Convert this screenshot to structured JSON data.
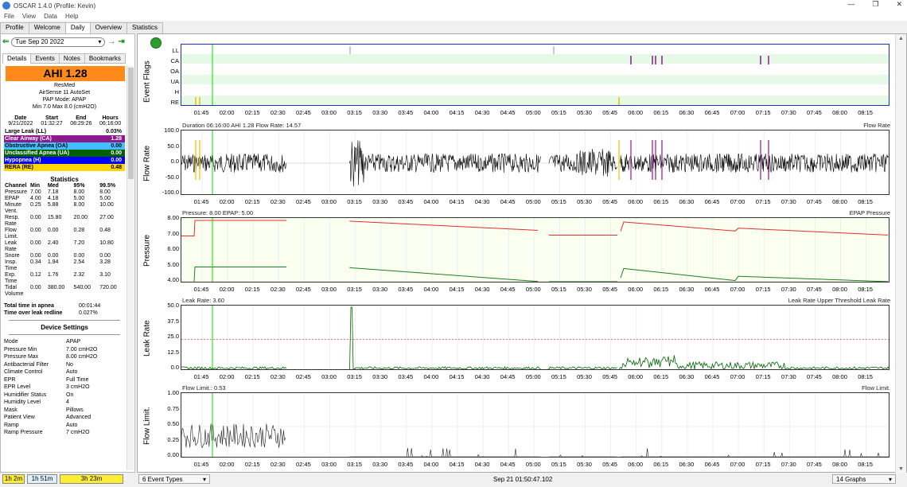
{
  "window": {
    "title": "OSCAR 1.4.0 (Profile: Kevin)",
    "controls": [
      "—",
      "❐",
      "✕"
    ]
  },
  "menu": [
    "File",
    "View",
    "Data",
    "Help"
  ],
  "tabs": [
    "Profile",
    "Welcome",
    "Daily",
    "Overview",
    "Statistics"
  ],
  "active_tab": "Daily",
  "date": {
    "prev": "⇐",
    "value": "Tue Sep 20 2022",
    "next": "→",
    "latest": "⇥"
  },
  "subtabs": [
    "Details",
    "Events",
    "Notes",
    "Bookmarks"
  ],
  "ahi": "AHI 1.28",
  "device": {
    "brand": "ResMed",
    "model": "AirSense 11 AutoSet",
    "mode": "PAP Mode: APAP",
    "pressure": "Min 7.0 Max 8.0 (cmH2O)"
  },
  "session": {
    "headers": [
      "Date",
      "Start",
      "End",
      "Hours"
    ],
    "values": [
      "9/21/2022",
      "01:32:27",
      "08:29:26",
      "06:16:00"
    ]
  },
  "events": [
    {
      "label": "Large Leak (LL)",
      "value": "0.03%",
      "bg": "#ffffff",
      "fg": "#000000"
    },
    {
      "label": "Clear Airway (CA)",
      "value": "1.28",
      "bg": "#8b1a8b",
      "fg": "#ffffff"
    },
    {
      "label": "Obstructive Apnea (OA)",
      "value": "0.00",
      "bg": "#40c0ff",
      "fg": "#000000"
    },
    {
      "label": "Unclassified Apnea (UA)",
      "value": "0.00",
      "bg": "#006000",
      "fg": "#ffffff"
    },
    {
      "label": "Hypopnea (H)",
      "value": "0.00",
      "bg": "#0000ff",
      "fg": "#ffffff"
    },
    {
      "label": "RERA (RE)",
      "value": "0.48",
      "bg": "#ffd700",
      "fg": "#000000"
    }
  ],
  "statistics": {
    "title": "Statistics",
    "headers": [
      "Channel",
      "Min",
      "Med",
      "95%",
      "99.5%"
    ],
    "rows": [
      [
        "Pressure",
        "7.00",
        "7.18",
        "8.00",
        "8.00"
      ],
      [
        "EPAP",
        "4.00",
        "4.18",
        "5.00",
        "5.00"
      ],
      [
        "Minute Vent.",
        "0.25",
        "5.88",
        "8.00",
        "10.00"
      ],
      [
        "Resp. Rate",
        "0.00",
        "15.80",
        "20.00",
        "27.00"
      ],
      [
        "Flow Limit.",
        "0.00",
        "0.00",
        "0.28",
        "0.48"
      ],
      [
        "Leak Rate",
        "0.00",
        "2.40",
        "7.20",
        "10.80"
      ],
      [
        "Snore",
        "0.00",
        "0.00",
        "0.00",
        "0.00"
      ],
      [
        "Insp. Time",
        "0.34",
        "1.94",
        "2.54",
        "3.28"
      ],
      [
        "Exp. Time",
        "0.12",
        "1.76",
        "2.32",
        "3.10"
      ],
      [
        "Tidal Volume",
        "0.00",
        "380.00",
        "540.00",
        "720.00"
      ]
    ]
  },
  "totals": [
    {
      "label": "Total time in apnea",
      "value": "00:01:44"
    },
    {
      "label": "Time over leak redline",
      "value": "0.027%"
    }
  ],
  "settings": {
    "title": "Device Settings",
    "rows": [
      [
        "Mode",
        "APAP"
      ],
      [
        "Pressure Min",
        "7.00 cmH2O"
      ],
      [
        "Pressure Max",
        "8.00 cmH2O"
      ],
      [
        "Antibacterial Filter",
        "No"
      ],
      [
        "Climate Control",
        "Auto"
      ],
      [
        "EPR",
        "Full Time"
      ],
      [
        "EPR Level",
        "3 cmH2O"
      ],
      [
        "Humidifier Status",
        "On"
      ],
      [
        "Humidity Level",
        "4"
      ],
      [
        "Mask",
        "Pillows"
      ],
      [
        "Patient View",
        "Advanced"
      ],
      [
        "Ramp",
        "Auto"
      ],
      [
        "Ramp Pressure",
        "7 cmH2O"
      ]
    ]
  },
  "bottom_buttons": [
    {
      "label": "1h 2m",
      "bg": "#ffee33"
    },
    {
      "label": "1h 51m",
      "bg": "#dff1ff"
    },
    {
      "label": "3h 23m",
      "bg": "#ffee33"
    }
  ],
  "x_ticks": [
    "01:45",
    "02:00",
    "02:15",
    "02:30",
    "02:45",
    "03:00",
    "03:15",
    "03:30",
    "03:45",
    "04:00",
    "04:15",
    "04:30",
    "04:45",
    "05:00",
    "05:15",
    "05:30",
    "05:45",
    "06:00",
    "06:15",
    "06:30",
    "06:45",
    "07:00",
    "07:15",
    "07:30",
    "07:45",
    "08:00",
    "08:15"
  ],
  "graphs": {
    "events": {
      "label": "Event Flags",
      "rows": [
        "LL",
        "CA",
        "OA",
        "UA",
        "H",
        "RE"
      ]
    },
    "flow": {
      "label": "Flow Rate",
      "info": "Duration 06:16:00 AHI 1.28 Flow Rate: 14.57",
      "legend": "Flow Rate",
      "yticks": [
        "100.0",
        "50.0",
        "0.0",
        "-50.0",
        "-100.0"
      ]
    },
    "pressure": {
      "label": "Pressure",
      "info": "Pressure: 8.00 EPAP: 5.00",
      "legend": "EPAP Pressure",
      "yticks": [
        "8.00",
        "7.00",
        "6.00",
        "5.00",
        "4.00"
      ]
    },
    "leak": {
      "label": "Leak Rate",
      "info": "Leak Rate: 3.60",
      "legend": "Leak Rate Upper Threshold Leak Rate",
      "yticks": [
        "50.0",
        "37.5",
        "25.0",
        "12.5",
        "0.0"
      ]
    },
    "flowlimit": {
      "label": "Flow Limit.",
      "info": "Flow Limit.: 0.53",
      "legend": "Flow Limit.",
      "yticks": [
        "1.00",
        "0.75",
        "0.50",
        "0.25",
        "0.00"
      ]
    }
  },
  "status": {
    "event_types": "6 Event Types",
    "timestamp": "Sep 21 01:50:47.102",
    "graphs": "14 Graphs"
  },
  "colors": {
    "ca": "#8b1a8b",
    "rera": "#e8c000",
    "pressure": "#e03030",
    "epap": "#208020",
    "leak": "#006600",
    "cursor": "#00dd00",
    "grid_band": "#e6f8e6"
  }
}
